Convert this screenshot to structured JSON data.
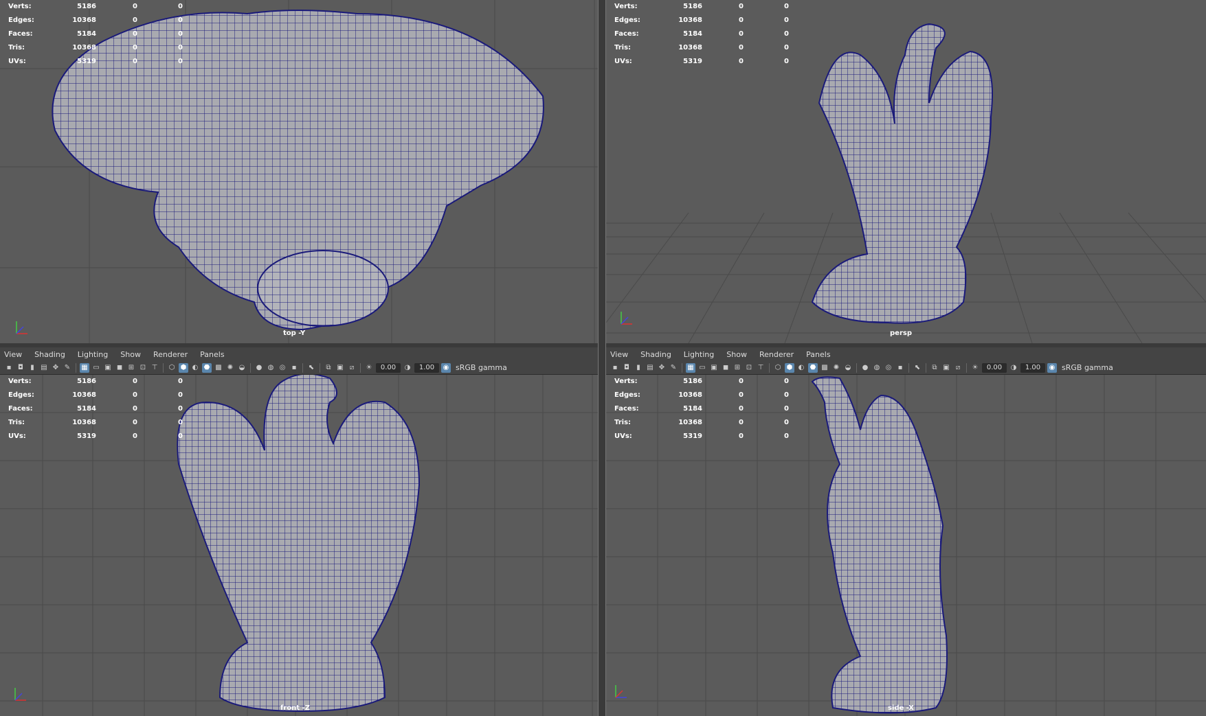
{
  "stats_rows": [
    {
      "label": "Verts:",
      "total": "5186",
      "sel": "0",
      "tri": "0"
    },
    {
      "label": "Edges:",
      "total": "10368",
      "sel": "0",
      "tri": "0"
    },
    {
      "label": "Faces:",
      "total": "5184",
      "sel": "0",
      "tri": "0"
    },
    {
      "label": "Tris:",
      "total": "10368",
      "sel": "0",
      "tri": "0"
    },
    {
      "label": "UVs:",
      "total": "5319",
      "sel": "0",
      "tri": "0"
    }
  ],
  "menu": [
    "View",
    "Shading",
    "Lighting",
    "Show",
    "Renderer",
    "Panels"
  ],
  "toolbar": {
    "exposure": "0.00",
    "gamma": "1.00",
    "color_space": "sRGB gamma"
  },
  "viewports": {
    "top": {
      "camera": "top -Y"
    },
    "persp": {
      "camera": "persp"
    },
    "front": {
      "camera": "front -Z"
    },
    "side": {
      "camera": "side -X"
    }
  },
  "colors": {
    "viewport_bg": "#5b5b5b",
    "wire": "#1a1a7a",
    "mesh": "#a9aab0",
    "select": "#5a86ad"
  }
}
